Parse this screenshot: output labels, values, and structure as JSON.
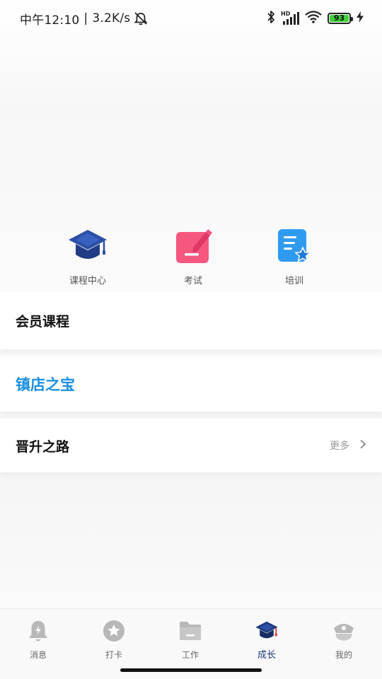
{
  "status": {
    "time": "中午12:10",
    "separator": "|",
    "speed": "3.2K/s",
    "network_label": "HD",
    "battery_level": "93"
  },
  "entries": [
    {
      "label": "课程中心",
      "icon": "graduation-cap-icon"
    },
    {
      "label": "考试",
      "icon": "exam-pencil-icon"
    },
    {
      "label": "培训",
      "icon": "training-document-icon"
    }
  ],
  "cards": {
    "member_courses": "会员课程",
    "store_treasure": "镇店之宝",
    "promotion_path": "晋升之路",
    "more_label": "更多"
  },
  "nav": [
    {
      "label": "消息",
      "icon": "bell-icon"
    },
    {
      "label": "打卡",
      "icon": "star-badge-icon"
    },
    {
      "label": "工作",
      "icon": "folder-icon"
    },
    {
      "label": "成长",
      "icon": "graduation-cap-icon"
    },
    {
      "label": "我的",
      "icon": "police-cap-icon"
    }
  ],
  "colors": {
    "accent_blue": "#1a8fe0",
    "nav_active": "#1d3a7a",
    "exam_pink": "#f5577f",
    "training_blue": "#2f9bf0",
    "cap_blue": "#2d4fa6"
  }
}
